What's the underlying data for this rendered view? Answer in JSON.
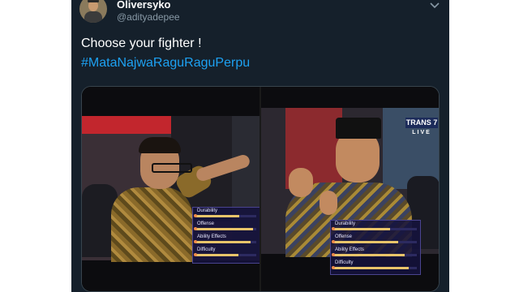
{
  "tweet": {
    "display_name": "Oliversyko",
    "handle": "@adityadepee",
    "menu_icon": "chevron-down-icon",
    "text_line1": "Choose your fighter !",
    "hashtag": "#MataNajwaRaguRaguPerpu"
  },
  "media": {
    "logo_brand": "TRANS 7",
    "logo_live": "LIVE",
    "left_stats": [
      {
        "label": "Durability",
        "level": 0.72
      },
      {
        "label": "Offense",
        "level": 0.95
      },
      {
        "label": "Ability Effects",
        "level": 0.9
      },
      {
        "label": "Difficulty",
        "level": 0.7
      }
    ],
    "right_stats": [
      {
        "label": "Durability",
        "level": 0.68
      },
      {
        "label": "Offense",
        "level": 0.78
      },
      {
        "label": "Ability Effects",
        "level": 0.85
      },
      {
        "label": "Difficulty",
        "level": 0.9
      }
    ]
  },
  "colors": {
    "background": "#15202b",
    "text": "#ffffff",
    "secondary_text": "#8899a6",
    "link": "#1da1f2"
  }
}
